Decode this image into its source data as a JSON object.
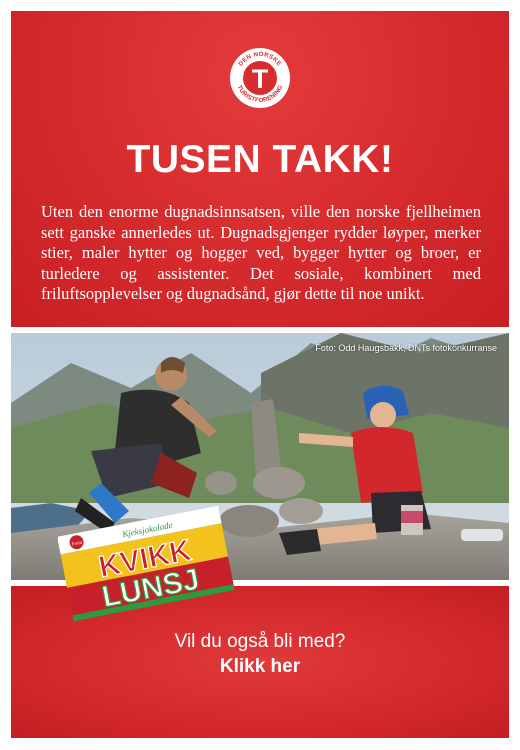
{
  "logo": {
    "ring_text": "DEN NORSKE TURISTFORENING",
    "letter": "T",
    "icon": "dnt-logo-icon"
  },
  "headline": "TUSEN TAKK!",
  "body": "Uten den enorme dugnadsinnsatsen, ville den norske fjellheimen sett ganske annerledes ut. Dugnadsgjenger rydder løyper, merker stier, maler hytter og hogger ved, bygger hytter og broer, er turledere og assistenter. Det sosiale, kombinert med friluftsopplevelser og dugnadsånd, gjør dette til noe unikt.",
  "photo": {
    "credit": "Foto: Odd Haugsbakk, DNTs fotokonkurranse"
  },
  "candy": {
    "top_label": "Kjeksjokolade",
    "line1": "KVIKK",
    "line2": "LUNSJ",
    "brand": "Freia"
  },
  "cta": {
    "question": "Vil du også bli med?",
    "link": "Klikk her"
  },
  "colors": {
    "primary_red": "#d82d2f",
    "text": "#ffffff"
  }
}
